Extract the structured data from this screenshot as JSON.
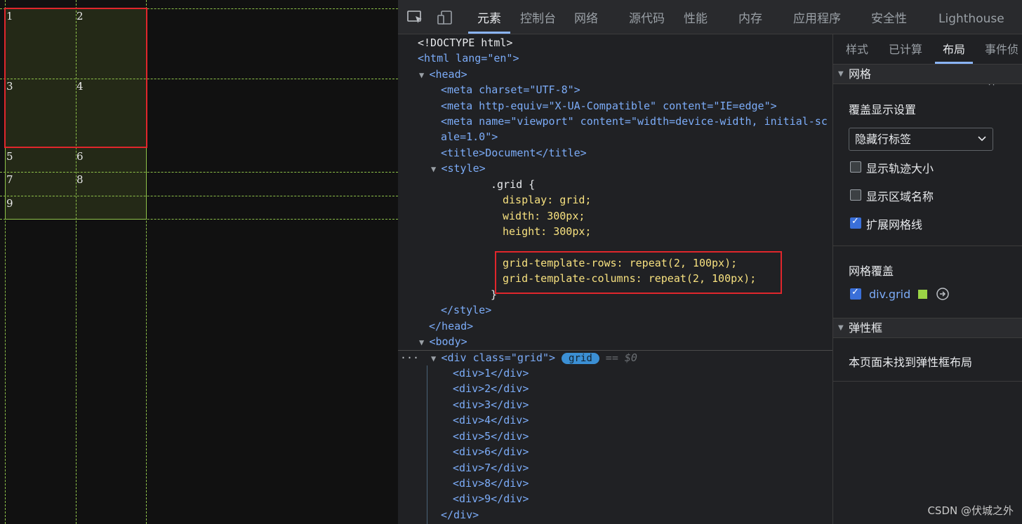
{
  "viewport": {
    "cells": [
      "1",
      "2",
      "3",
      "4",
      "5",
      "6",
      "7",
      "8",
      "9"
    ]
  },
  "devtools": {
    "tabs": [
      "元素",
      "控制台",
      "网络",
      "源代码",
      "性能",
      "内存",
      "应用程序",
      "安全性",
      "Lighthouse"
    ],
    "active_tab": "元素",
    "source": {
      "doctype": "<!DOCTYPE html>",
      "html_open": "<html lang=\"en\">",
      "head_open": "<head>",
      "meta_charset": "<meta charset=\"UTF-8\">",
      "meta_compat": "<meta http-equiv=\"X-UA-Compatible\" content=\"IE=edge\">",
      "meta_viewport_1": "<meta name=\"viewport\" content=\"width=device-width, initial-sc",
      "meta_viewport_2": "ale=1.0\">",
      "title": "<title>Document</title>",
      "style_open": "<style>",
      "css_selector": ".grid {",
      "css_display": "display: grid;",
      "css_width": "width: 300px;",
      "css_height": "height: 300px;",
      "css_rows": "grid-template-rows: repeat(2, 100px);",
      "css_cols": "grid-template-columns: repeat(2, 100px);",
      "css_close": "}",
      "style_close": "</style>",
      "head_close": "</head>",
      "body_open": "<body>",
      "div_grid_open": "<div class=\"grid\">",
      "badge": "grid",
      "dollar": "== $0",
      "children": [
        "<div>1</div>",
        "<div>2</div>",
        "<div>3</div>",
        "<div>4</div>",
        "<div>5</div>",
        "<div>6</div>",
        "<div>7</div>",
        "<div>8</div>",
        "<div>9</div>"
      ],
      "div_close": "</div>"
    },
    "sidebar": {
      "tabs": [
        "样式",
        "已计算",
        "布局",
        "事件侦听"
      ],
      "active_tab": "布局",
      "grid_section": "网格",
      "overlay_settings_title": "覆盖显示设置",
      "select_value": "隐藏行标签",
      "checkboxes": [
        {
          "label": "显示轨迹大小",
          "checked": false
        },
        {
          "label": "显示区域名称",
          "checked": false
        },
        {
          "label": "扩展网格线",
          "checked": true
        }
      ],
      "grid_overlay_title": "网格覆盖",
      "grid_overlay_item": {
        "label": "div.grid",
        "checked": true,
        "swatch_color": "#9bd545"
      },
      "flex_section": "弹性框",
      "flex_empty": "本页面未找到弹性框布局"
    }
  },
  "watermark": "CSDN @伏城之外"
}
